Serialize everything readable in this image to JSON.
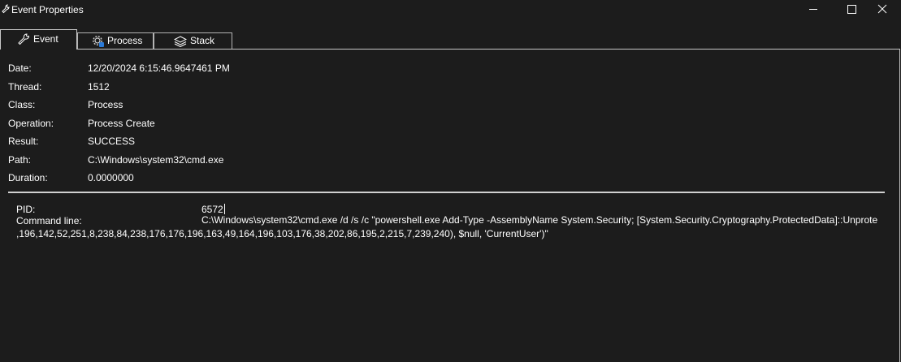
{
  "window": {
    "title": "Event Properties",
    "controls": [
      "minimize-icon",
      "maximize-icon",
      "close-icon"
    ]
  },
  "tabs": [
    {
      "label": "Event",
      "icon": "wrench-icon",
      "active": true
    },
    {
      "label": "Process",
      "icon": "gear-process-icon",
      "active": false
    },
    {
      "label": "Stack",
      "icon": "layers-icon",
      "active": false
    }
  ],
  "event": {
    "date_label": "Date:",
    "date_value": "12/20/2024 6:15:46.9647461 PM",
    "thread_label": "Thread:",
    "thread_value": "1512",
    "class_label": "Class:",
    "class_value": "Process",
    "operation_label": "Operation:",
    "operation_value": "Process Create",
    "result_label": "Result:",
    "result_value": "SUCCESS",
    "path_label": "Path:",
    "path_value": "C:\\Windows\\system32\\cmd.exe",
    "duration_label": "Duration:",
    "duration_value": "0.0000000"
  },
  "details": {
    "pid_label": "PID:",
    "pid_value": "6572",
    "cmdline_label": "Command line:",
    "cmdline_value_line1": "C:\\Windows\\system32\\cmd.exe /d /s /c \"powershell.exe Add-Type -AssemblyName System.Security; [System.Security.Cryptography.ProtectedData]::Unprotec",
    "cmdline_value_line2": ",196,142,52,251,8,238,84,238,176,176,196,163,49,164,196,103,176,38,202,86,195,2,215,7,239,240), $null, 'CurrentUser')\""
  }
}
